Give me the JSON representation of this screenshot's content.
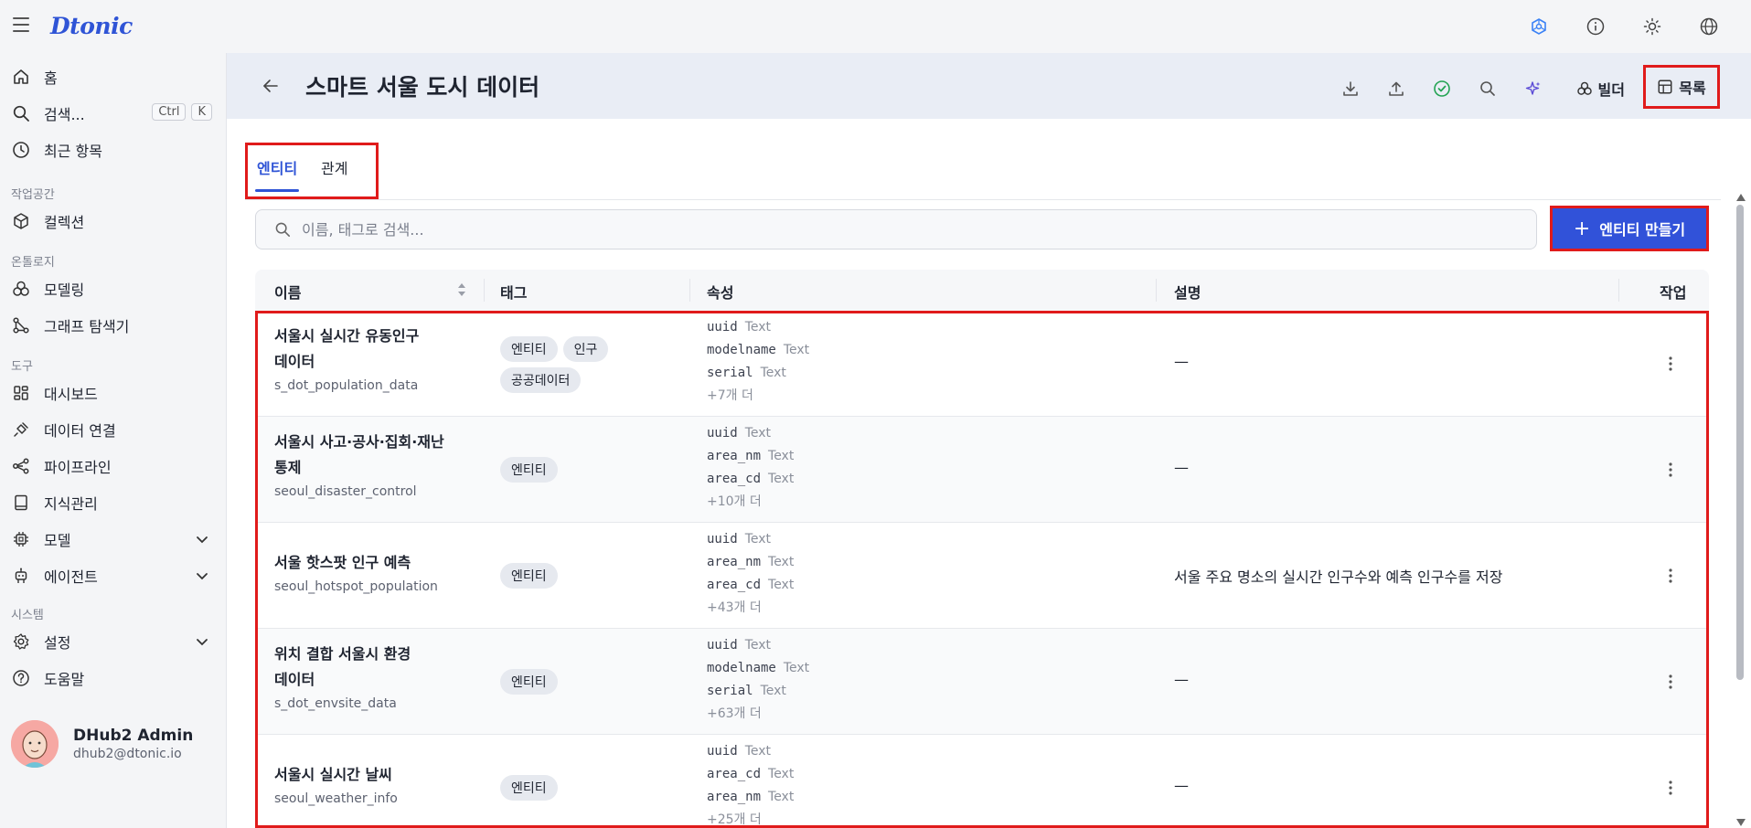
{
  "app": {
    "logo": "Dtonic"
  },
  "sidebar": {
    "home": "홈",
    "search": "검색...",
    "search_keys": [
      "Ctrl",
      "K"
    ],
    "recent": "최근 항목",
    "section_workspace": "작업공간",
    "collections": "컬렉션",
    "section_ontology": "온톨로지",
    "modeling": "모델링",
    "graph_explorer": "그래프 탐색기",
    "section_tools": "도구",
    "dashboard": "대시보드",
    "data_connection": "데이터 연결",
    "pipeline": "파이프라인",
    "knowledge": "지식관리",
    "model": "모델",
    "agent": "에이전트",
    "section_system": "시스템",
    "settings": "설정",
    "help": "도움말"
  },
  "user": {
    "name": "DHub2 Admin",
    "email": "dhub2@dtonic.io"
  },
  "header": {
    "title": "스마트 서울 도시 데이터",
    "builder_label": "빌더",
    "list_label": "목록"
  },
  "tabs": {
    "entity": "엔티티",
    "relation": "관계"
  },
  "search": {
    "placeholder": "이름, 태그로 검색..."
  },
  "create_button": "엔티티 만들기",
  "table": {
    "columns": {
      "name": "이름",
      "tags": "태그",
      "attributes": "속성",
      "description": "설명",
      "actions": "작업"
    },
    "rows": [
      {
        "name_line1": "서울시 실시간 유동인구",
        "name_line2": "데이터",
        "code": "s_dot_population_data",
        "tags": [
          "엔티티",
          "인구",
          "공공데이터"
        ],
        "attrs": [
          {
            "name": "uuid",
            "type": "Text"
          },
          {
            "name": "modelname",
            "type": "Text"
          },
          {
            "name": "serial",
            "type": "Text"
          }
        ],
        "more": "+7개 더",
        "description": "—"
      },
      {
        "name_line1": "서울시 사고·공사·집회·재난",
        "name_line2": "통제",
        "code": "seoul_disaster_control",
        "tags": [
          "엔티티"
        ],
        "attrs": [
          {
            "name": "uuid",
            "type": "Text"
          },
          {
            "name": "area_nm",
            "type": "Text"
          },
          {
            "name": "area_cd",
            "type": "Text"
          }
        ],
        "more": "+10개 더",
        "description": "—"
      },
      {
        "name_line1": "서울 핫스팟 인구 예측",
        "name_line2": "",
        "code": "seoul_hotspot_population",
        "tags": [
          "엔티티"
        ],
        "attrs": [
          {
            "name": "uuid",
            "type": "Text"
          },
          {
            "name": "area_nm",
            "type": "Text"
          },
          {
            "name": "area_cd",
            "type": "Text"
          }
        ],
        "more": "+43개 더",
        "description": "서울 주요 명소의 실시간 인구수와 예측 인구수를 저장"
      },
      {
        "name_line1": "위치 결합 서울시 환경",
        "name_line2": "데이터",
        "code": "s_dot_envsite_data",
        "tags": [
          "엔티티"
        ],
        "attrs": [
          {
            "name": "uuid",
            "type": "Text"
          },
          {
            "name": "modelname",
            "type": "Text"
          },
          {
            "name": "serial",
            "type": "Text"
          }
        ],
        "more": "+63개 더",
        "description": "—"
      },
      {
        "name_line1": "서울시 실시간 날씨",
        "name_line2": "",
        "code": "seoul_weather_info",
        "tags": [
          "엔티티"
        ],
        "attrs": [
          {
            "name": "uuid",
            "type": "Text"
          },
          {
            "name": "area_cd",
            "type": "Text"
          },
          {
            "name": "area_nm",
            "type": "Text"
          }
        ],
        "more": "+25개 더",
        "description": "—"
      }
    ]
  },
  "colors": {
    "accent": "#2f54d6",
    "primary_button": "#3152d9",
    "highlight": "#e01b1b"
  }
}
